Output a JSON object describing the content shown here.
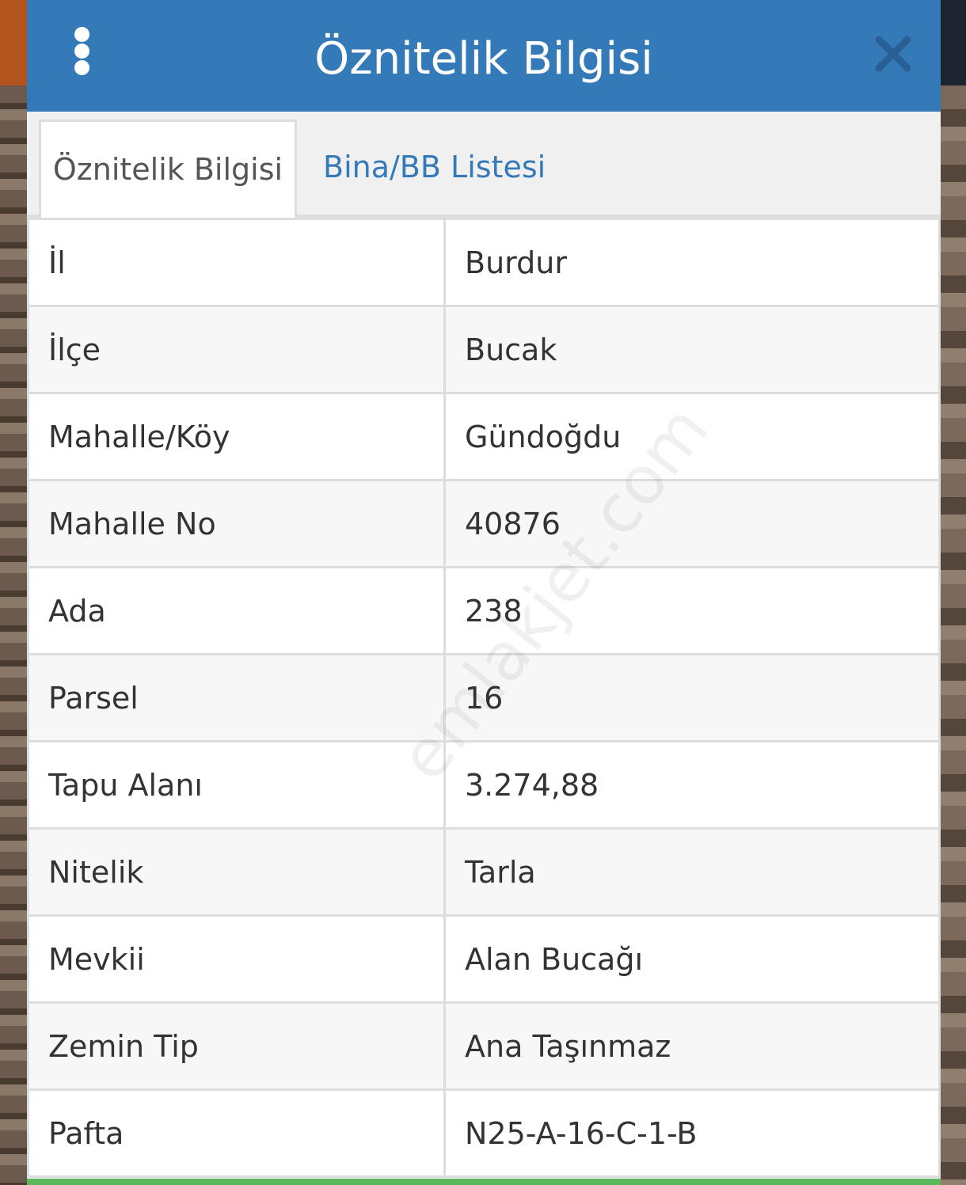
{
  "header": {
    "title": "Öznitelik Bilgisi",
    "menu_icon": "vertical-dots-icon",
    "close_icon": "close-icon"
  },
  "tabs": [
    {
      "label": "Öznitelik Bilgisi",
      "active": true
    },
    {
      "label": "Bina/BB Listesi",
      "active": false
    }
  ],
  "attributes": [
    {
      "key": "İl",
      "value": "Burdur"
    },
    {
      "key": "İlçe",
      "value": "Bucak"
    },
    {
      "key": "Mahalle/Köy",
      "value": "Gündoğdu"
    },
    {
      "key": "Mahalle No",
      "value": "40876"
    },
    {
      "key": "Ada",
      "value": "238"
    },
    {
      "key": "Parsel",
      "value": "16"
    },
    {
      "key": "Tapu Alanı",
      "value": "3.274,88"
    },
    {
      "key": "Nitelik",
      "value": "Tarla"
    },
    {
      "key": "Mevkii",
      "value": "Alan Bucağı"
    },
    {
      "key": "Zemin Tip",
      "value": "Ana Taşınmaz"
    },
    {
      "key": "Pafta",
      "value": "N25-A-16-C-1-B"
    }
  ],
  "watermark": "emlakjet.com",
  "colors": {
    "header": "#357ab8",
    "tab_link": "#357ab8",
    "bottom_bar": "#5cb85c"
  }
}
